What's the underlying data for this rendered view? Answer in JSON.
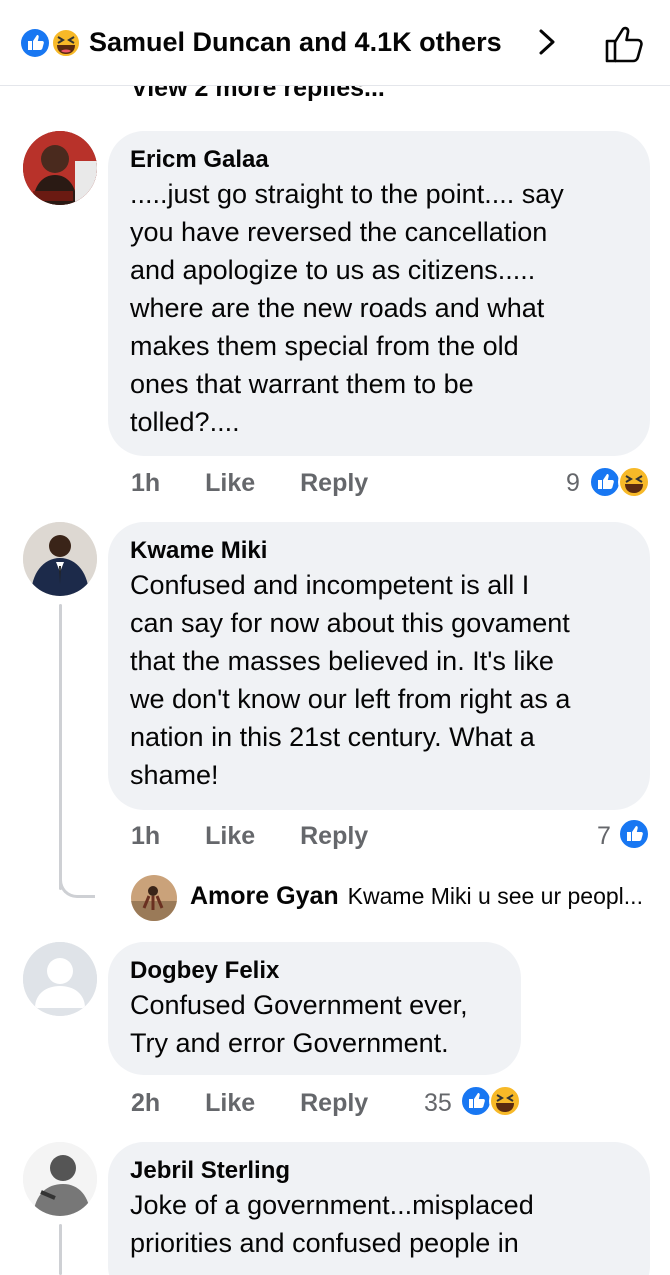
{
  "header": {
    "title": "Samuel Duncan and 4.1K others"
  },
  "more_replies": "View 2 more replies...",
  "comments": [
    {
      "author": "Ericm Galaa",
      "lines": [
        ".....just go straight to the point....  say",
        "you have reversed the cancellation",
        "and apologize to us as citizens.....",
        "where are the new roads and what",
        "makes them special from the old",
        "ones that warrant them to be",
        "tolled?...."
      ],
      "time": "1h",
      "like": "Like",
      "reply": "Reply",
      "reactions_count": "9"
    },
    {
      "author": "Kwame Miki",
      "lines": [
        "Confused and incompetent is all I",
        "can say for now about this govament",
        "that the masses believed in. It's like",
        "we don't know our left from right as a",
        "nation in this 21st century. What a",
        "shame!"
      ],
      "time": "1h",
      "like": "Like",
      "reply": "Reply",
      "reactions_count": "7"
    },
    {
      "author": "Dogbey Felix",
      "lines": [
        "Confused Government ever,",
        "Try and error Government."
      ],
      "time": "2h",
      "like": "Like",
      "reply": "Reply",
      "reactions_count": "35"
    },
    {
      "author": "Jebril Sterling",
      "lines": [
        "Joke of a government...misplaced",
        "priorities and confused people in"
      ]
    }
  ],
  "reply_preview": {
    "author": "Amore Gyan",
    "text": "Kwame Miki u see ur peopl..."
  },
  "colors": {
    "like_blue": "#1877f2",
    "haha_yellow": "#f7b928",
    "bubble_bg": "#f0f2f5",
    "secondary_text": "#65676b"
  },
  "icons": [
    "like-reaction-icon",
    "haha-reaction-icon",
    "chevron-right-icon",
    "thumbs-up-outline-icon"
  ]
}
